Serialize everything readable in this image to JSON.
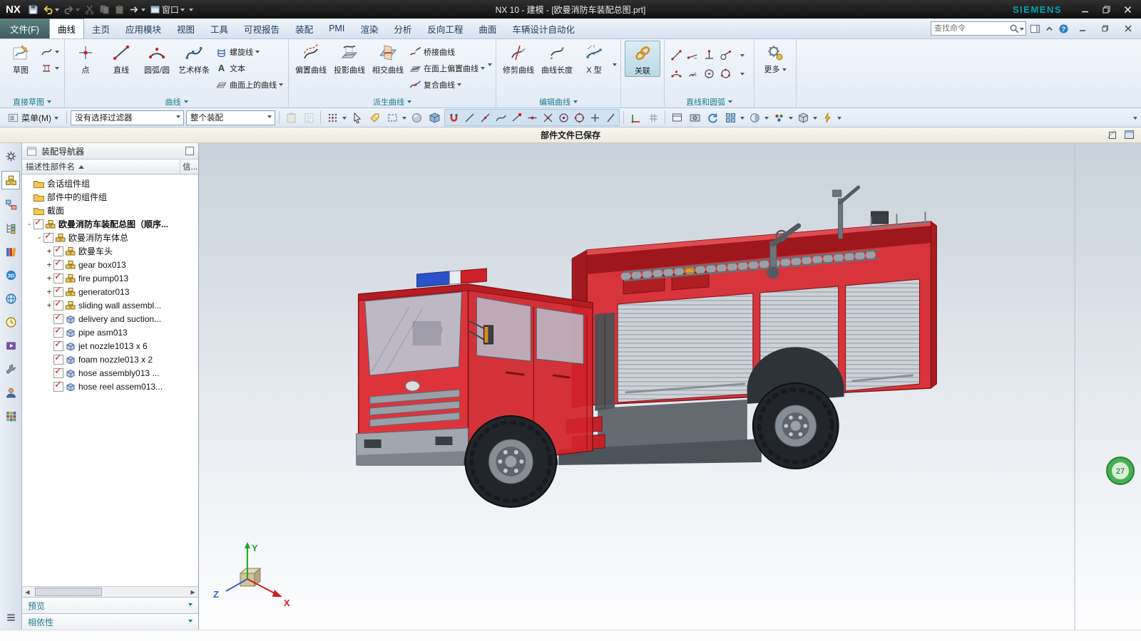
{
  "colors": {
    "accent_teal": "#1a7d92",
    "truck_red": "#d8252c",
    "brand_teal": "#00a5b5",
    "check_red": "#cf1418",
    "badge_green": "#46b050",
    "file_tab": "#3d5e5f"
  },
  "titlebar": {
    "logo": "NX",
    "title": "NX 10 - 建模 - [欧曼消防车装配总图.prt]",
    "brand": "SIEMENS",
    "window_menu": "窗口"
  },
  "tabs": {
    "file": "文件(F)",
    "items": [
      "曲线",
      "主页",
      "应用模块",
      "视图",
      "工具",
      "可视报告",
      "装配",
      "PMI",
      "渲染",
      "分析",
      "反向工程",
      "曲面",
      "车辆设计自动化"
    ],
    "search_placeholder": "查找命令"
  },
  "ribbon": {
    "g1": {
      "label": "直接草图",
      "sketch": "草图"
    },
    "g2": {
      "label": "曲线",
      "point": "点",
      "line": "直线",
      "arc": "圆弧/圆",
      "spline": "艺术样条",
      "helix": "螺旋线",
      "text": "文本",
      "cos": "曲面上的曲线"
    },
    "g3": {
      "label": "派生曲线",
      "offset": "偏置曲线",
      "project": "投影曲线",
      "intersect": "相交曲线",
      "bridge": "桥接曲线",
      "offset_face": "在面上偏置曲线",
      "composite": "复合曲线"
    },
    "g4": {
      "label": "编辑曲线",
      "trim": "修剪曲线",
      "length": "曲线长度",
      "xform": "X 型"
    },
    "g5": {
      "associate": "关联"
    },
    "g6": {
      "label": "直线和圆弧"
    },
    "g7": {
      "more": "更多"
    }
  },
  "toolbar": {
    "menu": "菜单(M)",
    "filter": "没有选择过滤器",
    "scope": "整个装配"
  },
  "prompt": {
    "message": "部件文件已保存"
  },
  "navigator": {
    "title": "装配导航器",
    "col_name": "描述性部件名",
    "col_info": "信...",
    "rows": [
      {
        "label": "会话组件组"
      },
      {
        "label": "部件中的组件组"
      },
      {
        "label": "截面"
      },
      {
        "label": "欧曼消防车装配总图（顺序..."
      },
      {
        "label": "欧曼消防车体总"
      },
      {
        "label": "欧曼车头"
      },
      {
        "label": "gear box013"
      },
      {
        "label": "fire pump013"
      },
      {
        "label": "generator013"
      },
      {
        "label": "sliding wall assembl..."
      },
      {
        "label": "delivery and suction..."
      },
      {
        "label": "pipe asm013"
      },
      {
        "label": "jet nozzle1013 x 6"
      },
      {
        "label": "foam nozzle013 x 2"
      },
      {
        "label": "hose assembly013 ..."
      },
      {
        "label": "hose reel assem013..."
      }
    ],
    "preview": "预览",
    "dependencies": "相依性"
  },
  "viewport": {
    "badge": "27",
    "axis_x": "X",
    "axis_y": "Y",
    "axis_z": "Z"
  }
}
